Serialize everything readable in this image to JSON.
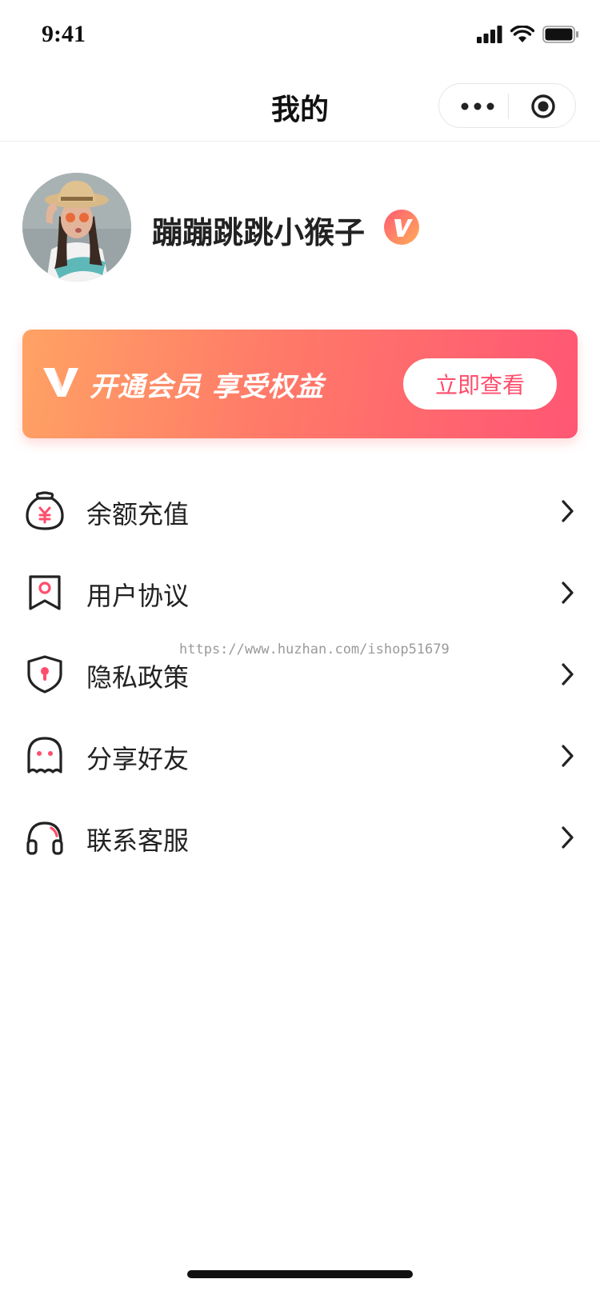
{
  "status_bar": {
    "time": "9:41",
    "icons": [
      "signal-icon",
      "wifi-icon",
      "battery-icon"
    ]
  },
  "nav": {
    "title": "我的",
    "capsule_icons": [
      "more-icon",
      "target-icon"
    ]
  },
  "profile": {
    "username": "蹦蹦跳跳小猴子",
    "badge_icon": "vip-v-icon",
    "avatar_icon": "avatar-photo"
  },
  "vip_banner": {
    "text": "开通会员 享受权益",
    "button_label": "立即查看",
    "logo_icon": "vip-logo-icon",
    "colors": {
      "from": "#ffa264",
      "to": "#ff5674",
      "button_text": "#ff4e6c"
    }
  },
  "menu": [
    {
      "label": "余额充值",
      "icon": "money-bag-icon"
    },
    {
      "label": "用户协议",
      "icon": "bookmark-icon"
    },
    {
      "label": "隐私政策",
      "icon": "shield-icon"
    },
    {
      "label": "分享好友",
      "icon": "ghost-icon"
    },
    {
      "label": "联系客服",
      "icon": "headset-icon"
    }
  ],
  "watermark": "https://www.huzhan.com/ishop51679",
  "colors": {
    "accent": "#ff4e6c",
    "text": "#222222"
  }
}
